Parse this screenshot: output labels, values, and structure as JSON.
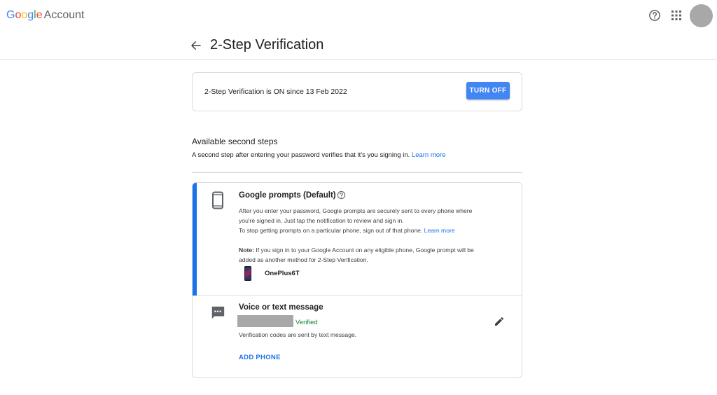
{
  "header": {
    "brand_letters": [
      "G",
      "o",
      "o",
      "g",
      "l",
      "e"
    ],
    "brand_suffix": "Account",
    "help_icon": "help-circle-icon",
    "apps_icon": "apps-grid-icon",
    "avatar": "avatar"
  },
  "page": {
    "back_icon": "arrow-back-icon",
    "title": "2-Step Verification"
  },
  "status": {
    "text": "2-Step Verification is ON since 13 Feb 2022",
    "turn_off_label": "TURN OFF"
  },
  "section": {
    "title": "Available second steps",
    "description": "A second step after entering your password verifies that it's you signing in.",
    "learn_more": "Learn more"
  },
  "prompts": {
    "icon": "smartphone-icon",
    "title": "Google prompts (Default)",
    "help_icon": "help-circle-icon",
    "line1": "After you enter your password, Google prompts are securely sent to every phone where",
    "line2": "you're signed in. Just tap the notification to review and sign in.",
    "line3": "To stop getting prompts on a particular phone, sign out of that phone.",
    "learn_more": "Learn more",
    "note_label": "Note:",
    "note_line1": "If you sign in to your Google Account on any eligible phone, Google prompt will be",
    "note_line2": "added as another method for 2-Step Verification.",
    "device_name": "OnePlus6T"
  },
  "voice": {
    "icon": "message-icon",
    "title": "Voice or text message",
    "verified": "Verified",
    "description": "Verification codes are sent by text message.",
    "add_phone": "ADD PHONE",
    "edit_icon": "pencil-icon"
  },
  "colors": {
    "accent": "#1a73e8",
    "button": "#4285f4",
    "verified": "#188038"
  }
}
